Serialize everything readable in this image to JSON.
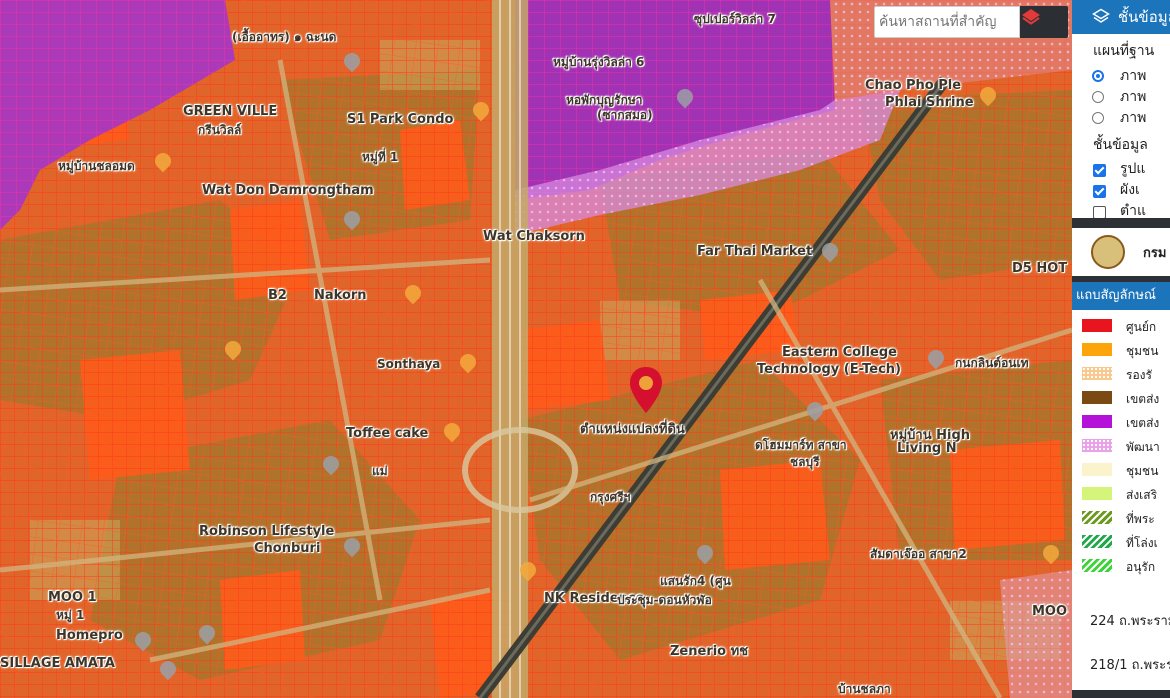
{
  "search": {
    "placeholder": "ค้นหาสถานที่สำคัญ"
  },
  "panel": {
    "title": "ชั้นข้อมูล",
    "basemap_heading": "แผนที่ฐาน",
    "basemap_options": [
      {
        "label": "ภาพ",
        "selected": true
      },
      {
        "label": "ภาพ",
        "selected": false
      },
      {
        "label": "ภาพ",
        "selected": false
      }
    ],
    "layers_heading": "ชั้นข้อมูล",
    "layer_options": [
      {
        "label": "รูปแ",
        "checked": true
      },
      {
        "label": "ผังเ",
        "checked": true
      },
      {
        "label": "ตำแ",
        "checked": false
      }
    ],
    "org_name": "กรม",
    "legend_heading": "แถบสัญลักษณ์",
    "legend": [
      {
        "label": "ศูนย์ก",
        "color": "#e8151e",
        "pattern": "solid"
      },
      {
        "label": "ชุมชน",
        "color": "#fca40a",
        "pattern": "solid"
      },
      {
        "label": "รองรั",
        "color": "#f8c88c",
        "pattern": "dots"
      },
      {
        "label": "เขตส่ง",
        "color": "#7a4a12",
        "pattern": "solid"
      },
      {
        "label": "เขตส่ง",
        "color": "#b412d8",
        "pattern": "solid"
      },
      {
        "label": "พัฒนา",
        "color": "#e9a0e8",
        "pattern": "dots"
      },
      {
        "label": "ชุมชน",
        "color": "#fbf3cc",
        "pattern": "solid"
      },
      {
        "label": "ส่งเสริ",
        "color": "#d4f57a",
        "pattern": "solid"
      },
      {
        "label": "ที่พระ",
        "color": "#6a9a1e",
        "pattern": "hatch"
      },
      {
        "label": "ที่โล่งเ",
        "color": "#20a84a",
        "pattern": "hatch"
      },
      {
        "label": "อนุรัก",
        "color": "#3fd23a",
        "pattern": "hatch"
      }
    ],
    "addresses": [
      "224 ถ.พระราม",
      "218/1 ถ.พระราม"
    ]
  },
  "map": {
    "marker_label": "ตำแหน่งแปลงที่ดิน",
    "places": [
      {
        "text": "(เอื้ออาทร) ๑ ฉะนด"
      },
      {
        "text": "GREEN VILLE"
      },
      {
        "text": "กรีนวิลล์"
      },
      {
        "text": "S1 Park Condo"
      },
      {
        "text": "หมู่ที่ 1"
      },
      {
        "text": "หมู่บ้านชลอมด"
      },
      {
        "text": "Wat Don Damrongtham"
      },
      {
        "text": "Wat Chaksorn"
      },
      {
        "text": "หมู่บ้านรุ่งวิลล่า 6"
      },
      {
        "text": "หอพักบุญรักษา"
      },
      {
        "text": "(ซากสมอ)"
      },
      {
        "text": "ซุปเปอร์วิลล่า 7"
      },
      {
        "text": "Chao Pho Ple"
      },
      {
        "text": "Phlai Shrine"
      },
      {
        "text": "Far Thai Market"
      },
      {
        "text": "D5 HOT"
      },
      {
        "text": "B2"
      },
      {
        "text": "Nakorn"
      },
      {
        "text": "Eastern College"
      },
      {
        "text": "Technology (E-Tech)"
      },
      {
        "text": "กนกลินต์อนเท"
      },
      {
        "text": "Toffee cake"
      },
      {
        "text": "หมู่บ้าน High"
      },
      {
        "text": "Living N"
      },
      {
        "text": "ดโฮมมาร์ท สาขา"
      },
      {
        "text": "ชลบุรี"
      },
      {
        "text": "Robinson Lifestyle"
      },
      {
        "text": "Chonburi"
      },
      {
        "text": "MOO 1"
      },
      {
        "text": "หมู่ 1"
      },
      {
        "text": "Homepro"
      },
      {
        "text": "SILLAGE AMATA"
      },
      {
        "text": "NK Residence"
      },
      {
        "text": "ประชุม-ดอนหัวฬ่อ"
      },
      {
        "text": "Zenerio ทช"
      },
      {
        "text": "แสนรัก4 (ศูน"
      },
      {
        "text": "สัมดาเจ๊ออ สาขา2"
      },
      {
        "text": "MOO"
      },
      {
        "text": "กรุงศรีฯ"
      },
      {
        "text": "Sonthaya"
      },
      {
        "text": "แม่"
      },
      {
        "text": "บ้านชลภา"
      }
    ]
  }
}
